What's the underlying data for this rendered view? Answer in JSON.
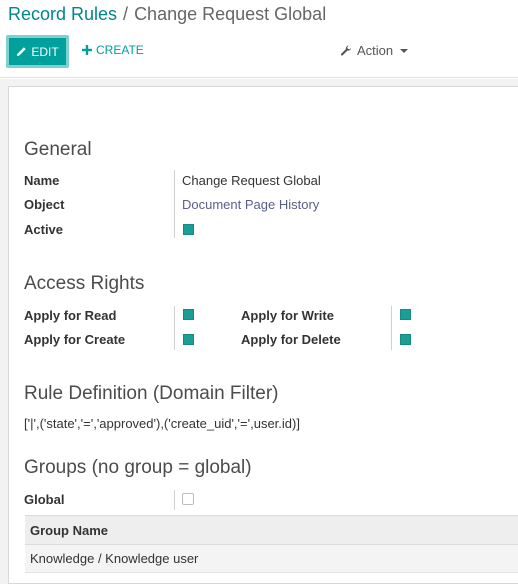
{
  "breadcrumb": {
    "parent": "Record Rules",
    "separator": "/",
    "current": "Change Request Global"
  },
  "toolbar": {
    "edit_label": "EDIT",
    "create_label": "CREATE",
    "action_label": "Action"
  },
  "general": {
    "title": "General",
    "name_label": "Name",
    "name_value": "Change Request Global",
    "object_label": "Object",
    "object_value": "Document Page History",
    "active_label": "Active"
  },
  "access": {
    "title": "Access Rights",
    "read_label": "Apply for Read",
    "write_label": "Apply for Write",
    "create_label": "Apply for Create",
    "delete_label": "Apply for Delete"
  },
  "rule": {
    "title": "Rule Definition (Domain Filter)",
    "domain": "['|',('state','=','approved'),('create_uid','=',user.id)]"
  },
  "groups": {
    "title": "Groups (no group = global)",
    "global_label": "Global",
    "column_header": "Group Name",
    "rows": [
      "Knowledge / Knowledge user"
    ]
  },
  "colors": {
    "accent": "#00a09d",
    "checkbox": "#1b9e96",
    "link": "#5a5f8a"
  }
}
